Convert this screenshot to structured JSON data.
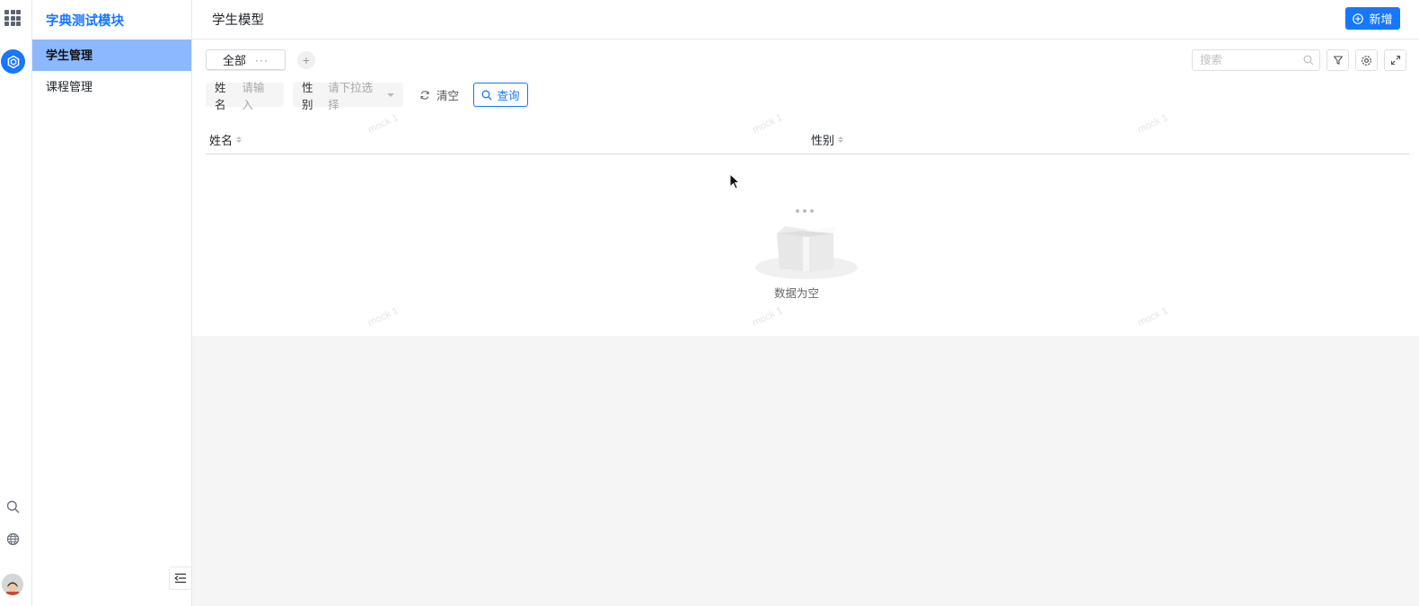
{
  "rail": {
    "icons": [
      "apps-grid-icon",
      "app-logo-icon",
      "search-icon",
      "globe-icon",
      "avatar"
    ]
  },
  "sidebar": {
    "module_title": "字典测试模块",
    "items": [
      {
        "label": "学生管理",
        "active": true
      },
      {
        "label": "课程管理",
        "active": false
      }
    ]
  },
  "header": {
    "title": "学生模型",
    "add_label": "新增"
  },
  "toolbar": {
    "view_tab": "全部",
    "view_tab_more": "···",
    "add_view": "+",
    "search_placeholder": "搜索"
  },
  "filters": {
    "name": {
      "label": "姓名",
      "placeholder": "请输入"
    },
    "gender": {
      "label": "性别",
      "placeholder": "请下拉选择"
    },
    "clear_label": "清空",
    "query_label": "查询"
  },
  "table": {
    "columns": [
      "姓名",
      "性别"
    ],
    "rows": [],
    "empty_text": "数据为空"
  },
  "watermark_text": "mock 1",
  "colors": {
    "accent": "#1677ff",
    "active_nav_bg": "#8cb8ff"
  }
}
